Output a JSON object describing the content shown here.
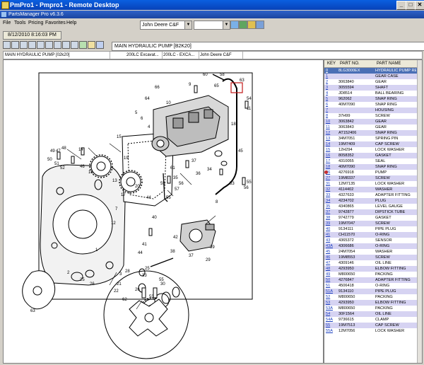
{
  "window": {
    "title": "PmPro1 - Pmpro1 - Remote Desktop",
    "subtitle": "PartsManager Pro v6.3.6"
  },
  "menu": [
    "File",
    "Tools",
    "Pricing",
    "Favorites",
    "Help"
  ],
  "toolbar": {
    "catalog_select": "John Deere C&F",
    "search_value": "",
    "date_tab": "8/12/2010 8:16:03 PM"
  },
  "breadcrumb": "MAIN HYDRAULIC PUMP [B2K20]",
  "pathbar": [
    "MAIN HYDRAULIC PUMP [02k20]",
    "200LC Excavat...",
    "200LC - EXCA...",
    "John Deere C&F"
  ],
  "diagram": {
    "callouts": [
      "1",
      "2",
      "3",
      "4",
      "5",
      "6",
      "7",
      "8",
      "9",
      "10",
      "11",
      "12",
      "13",
      "14",
      "15",
      "16",
      "17",
      "18",
      "19",
      "20",
      "21",
      "22",
      "25",
      "26",
      "27",
      "28",
      "29",
      "30",
      "33",
      "34",
      "35",
      "36",
      "37",
      "38",
      "39",
      "40",
      "41",
      "42",
      "43",
      "44",
      "45",
      "46",
      "47",
      "48",
      "49",
      "50",
      "51",
      "52",
      "53",
      "54",
      "55",
      "56",
      "57",
      "58",
      "59",
      "60",
      "61",
      "62",
      "63",
      "64",
      "65",
      "66"
    ]
  },
  "parts_table": {
    "columns": [
      "KEY",
      "PART NO.",
      "PART NAME"
    ],
    "rows": [
      [
        "0",
        "8LG3000EX",
        "HYDRAULIC PUMP REMAN"
      ],
      [
        "1",
        "",
        "GEAR CASE"
      ],
      [
        "2",
        "3063840",
        "GEAR"
      ],
      [
        "3",
        "3055594",
        "SHAFT"
      ],
      [
        "4",
        "JD8514",
        "BALL BEARING"
      ],
      [
        "5",
        "962062",
        "SNAP RING"
      ],
      [
        "6",
        "40M7090",
        "SNAP RING"
      ],
      [
        "7",
        "",
        "HOUSING"
      ],
      [
        "8",
        "37H99",
        "SCREW"
      ],
      [
        "9",
        "3063842",
        "GEAR"
      ],
      [
        "10",
        "3063843",
        "GEAR"
      ],
      [
        "11",
        "AT152406",
        "SNAP RING"
      ],
      [
        "12",
        "34M7051",
        "SPRING PIN"
      ],
      [
        "13",
        "19M7409",
        "CAP SCREW"
      ],
      [
        "14",
        "12H294",
        "LOCK WASHER"
      ],
      [
        "15",
        "8058352",
        "GASKET"
      ],
      [
        "16",
        "4310055",
        "SEAL"
      ],
      [
        "17",
        "40M7090",
        "SNAP RING"
      ],
      [
        "18",
        "4276918",
        "PUMP"
      ],
      [
        "19",
        "19M8337",
        "SCREW"
      ],
      [
        "20",
        "12M7135",
        "LOCK WASHER"
      ],
      [
        "21",
        "4114402",
        "WASHER"
      ],
      [
        "22",
        "4327633",
        "ADAPTER FITTING"
      ],
      [
        "23",
        "4234702",
        "PLUG"
      ],
      [
        "24",
        "4340865",
        "LEVEL GAUGE"
      ],
      [
        "25",
        "9742877",
        "DIPSTICK TUBE"
      ],
      [
        "26",
        "9742779",
        "GASKET"
      ],
      [
        "27",
        "19M7047",
        "SCREW"
      ],
      [
        "28",
        "9134111",
        "PIPE PLUG"
      ],
      [
        "29",
        "CH11570",
        "O-RING"
      ],
      [
        "30",
        "4365372",
        "SENSOR"
      ],
      [
        "31",
        "4306686",
        "O-RING"
      ],
      [
        "32",
        "24M7054",
        "WASHER"
      ],
      [
        "33",
        "19M8553",
        "SCREW"
      ],
      [
        "34",
        "4309146",
        "OIL LINE"
      ],
      [
        "35",
        "4293950",
        "ELBOW FITTING"
      ],
      [
        "36",
        "M800650",
        "PACKING"
      ],
      [
        "37",
        "4276847",
        "ADAPTER FITTING"
      ],
      [
        "38",
        "4506418",
        "O-RING"
      ],
      [
        "39",
        "9134110",
        "PIPE PLUG"
      ],
      [
        "40",
        "M800650",
        "PACKING"
      ],
      [
        "41",
        "4293950",
        "ELBOW FITTING"
      ],
      [
        "42",
        "M800650",
        "PACKING"
      ],
      [
        "43",
        "30F1564",
        "OIL LINE"
      ],
      [
        "44",
        "9736615",
        "CLAMP"
      ],
      [
        "45",
        "19M7513",
        "CAP SCREW"
      ],
      [
        "46",
        "12M7056",
        "LOCK WASHER"
      ]
    ],
    "key_labels": [
      "0",
      "1",
      "2",
      "3",
      "4",
      "5",
      "6",
      "7",
      "8",
      "10",
      "11",
      "12",
      "13",
      "14",
      "15",
      "16",
      "17",
      "18",
      "26",
      "27",
      "31",
      "32",
      "33",
      "34",
      "35",
      "37",
      "38",
      "39",
      "40",
      "41",
      "43",
      "43A",
      "45",
      "46",
      "47",
      "48",
      "49",
      "50",
      "51",
      "51A",
      "52",
      "53",
      "53A",
      "54",
      "54A",
      "55",
      "55A",
      "56",
      "57",
      "58",
      "59",
      "60"
    ],
    "selected_row": 0,
    "highlight_row": 18,
    "colors": {
      "selected": "#4a6fb5",
      "alt_row": "#d6d3f2",
      "highlight_icon": "#c83030"
    }
  }
}
